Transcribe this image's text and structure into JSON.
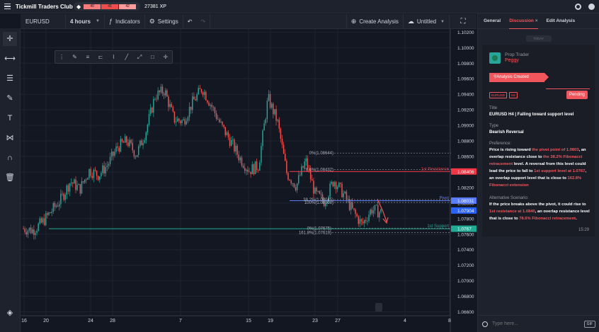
{
  "app": {
    "title": "Tickmill Traders Club",
    "xp": "27381 XP",
    "levels": [
      "40",
      "41",
      "42"
    ]
  },
  "toolbar": {
    "symbol": "EURUSD",
    "timeframe": "4 hours",
    "indicators": "Indicators",
    "settings": "Settings",
    "create": "Create Analysis",
    "layout": "Untitled"
  },
  "panel": {
    "tabs": [
      "General",
      "Discussion",
      "Edit Analysis"
    ],
    "today": "TODAY",
    "role": "Prop Trader",
    "user": "Peggy",
    "banner": "Analysis Created",
    "symbol_chip": "EURUSD",
    "tf_chip": "H4",
    "status": "Pending",
    "title_label": "Title",
    "title": "EURUSD H4 | Falling toward support level",
    "type_label": "Type",
    "type": "Bearish Reversal",
    "pref_label": "Preference:",
    "pref": [
      {
        "t": "Price is rising toward ",
        "h": false
      },
      {
        "t": "the pivot point of 1.0803",
        "h": true
      },
      {
        "t": ", an overlap resistance close to ",
        "h": false
      },
      {
        "t": "the 38.2% Fibonacci retracement",
        "h": true
      },
      {
        "t": " level. A reversal from this level could lead the price to fall to ",
        "h": false
      },
      {
        "t": "1st support level at 1.0767",
        "h": true
      },
      {
        "t": ", an overlap support level that is  close to ",
        "h": false
      },
      {
        "t": "162.8% Fibonacci extension",
        "h": true
      }
    ],
    "alt_label": "Alternative Scenario:",
    "alt": [
      {
        "t": "If the price breaks above the pivot, it could rise to ",
        "h": false
      },
      {
        "t": "1st resistance at 1.0840",
        "h": true
      },
      {
        "t": ", an overlap resistance level that is close to ",
        "h": false
      },
      {
        "t": "78.6% Fibonacci retracement",
        "h": true
      },
      {
        "t": ".",
        "h": false
      }
    ],
    "time": "15:29",
    "placeholder": "Type here...",
    "gif": "GIF"
  },
  "chart_data": {
    "type": "candlestick",
    "symbol": "EURUSD",
    "timeframe": "4 hours",
    "ylim": [
      1.0655,
      1.1024
    ],
    "ticks": [
      "1.10200",
      "1.10000",
      "1.09800",
      "1.09600",
      "1.09400",
      "1.09200",
      "1.09000",
      "1.08800",
      "1.08600",
      "1.08400",
      "1.08200",
      "1.08000",
      "1.07800",
      "1.07600",
      "1.07400",
      "1.07200",
      "1.07000",
      "1.06800",
      "1.06600"
    ],
    "x_labels": [
      "16",
      "20",
      "24",
      "28",
      "7",
      "15",
      "19",
      "23",
      "27",
      "4",
      "8"
    ],
    "levels": [
      {
        "name": "1st Resistance",
        "value": 1.08406,
        "label": "1.08406",
        "color": "#f23645"
      },
      {
        "name": "Pivot",
        "value": 1.08031,
        "label": "1.08031",
        "color": "#5b7cff"
      },
      {
        "name": "1st Support",
        "value": 1.0767,
        "label": "1.0767",
        "color": "#22ab94"
      }
    ],
    "price_tags": [
      {
        "label": "1.07904",
        "value": 1.07904,
        "color": "#2962ff"
      }
    ],
    "fibs": [
      {
        "label": "0%(1.08644)",
        "value": 1.08644
      },
      {
        "label": "78.6%(1.08432)",
        "value": 1.08432
      },
      {
        "label": "38.2%(1.08045)",
        "value": 1.08045
      },
      {
        "label": "100%(1.08008)",
        "value": 1.08008
      },
      {
        "label": "0%(1.07675)",
        "value": 1.07675
      },
      {
        "label": "161.8%(1.07619)",
        "value": 1.07619
      }
    ],
    "anchors": [
      1.0767,
      1.0765,
      1.0775,
      1.079,
      1.0805,
      1.0828,
      1.0818,
      1.0842,
      1.0836,
      1.085,
      1.0872,
      1.088,
      1.0862,
      1.0892,
      1.0938,
      1.0945,
      1.0908,
      1.0905,
      1.093,
      1.0948,
      1.0925,
      1.09,
      1.088,
      1.0858,
      1.0842,
      1.0848,
      1.0935,
      1.0905,
      1.0838,
      1.0822,
      1.0855,
      1.0812,
      1.0802,
      1.083,
      1.0812,
      1.079,
      1.0772,
      1.0792,
      1.0788
    ]
  }
}
